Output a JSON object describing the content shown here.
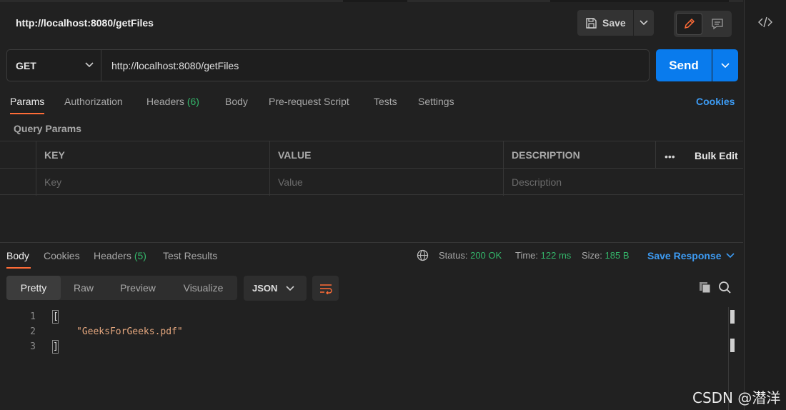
{
  "request": {
    "title": "http://localhost:8080/getFiles",
    "save_label": "Save",
    "method": "GET",
    "url": "http://localhost:8080/getFiles",
    "send_label": "Send"
  },
  "request_tabs": {
    "params": "Params",
    "authorization": "Authorization",
    "headers": "Headers",
    "headers_count": "(6)",
    "body": "Body",
    "pre_request": "Pre-request Script",
    "tests": "Tests",
    "settings": "Settings",
    "cookies": "Cookies"
  },
  "query_params": {
    "title": "Query Params",
    "columns": [
      "KEY",
      "VALUE",
      "DESCRIPTION"
    ],
    "placeholders": [
      "Key",
      "Value",
      "Description"
    ],
    "more_label": "•••",
    "bulk_edit": "Bulk Edit"
  },
  "response_tabs": {
    "body": "Body",
    "cookies": "Cookies",
    "headers": "Headers",
    "headers_count": "(5)",
    "test_results": "Test Results"
  },
  "response_status": {
    "status_label": "Status:",
    "status_value": "200 OK",
    "time_label": "Time:",
    "time_value": "122 ms",
    "size_label": "Size:",
    "size_value": "185 B",
    "save_response": "Save Response"
  },
  "view_tabs": [
    "Pretty",
    "Raw",
    "Preview",
    "Visualize"
  ],
  "format": "JSON",
  "code": {
    "line_numbers": [
      "1",
      "2",
      "3"
    ],
    "open_bracket": "[",
    "value": "\"GeeksForGeeks.pdf\"",
    "close_bracket": "]"
  },
  "watermark": "CSDN @潜洋",
  "colors": {
    "accent_orange": "#ff6c37",
    "send_blue": "#097bed",
    "link_blue": "#3d9bf3",
    "status_green": "#34b56a",
    "string_orange": "#e5a77e"
  },
  "icons": [
    "save-icon",
    "chevron-down-icon",
    "pencil-icon",
    "comment-icon",
    "code-icon",
    "globe-icon",
    "wrap-lines-icon",
    "copy-icon",
    "search-icon"
  ]
}
